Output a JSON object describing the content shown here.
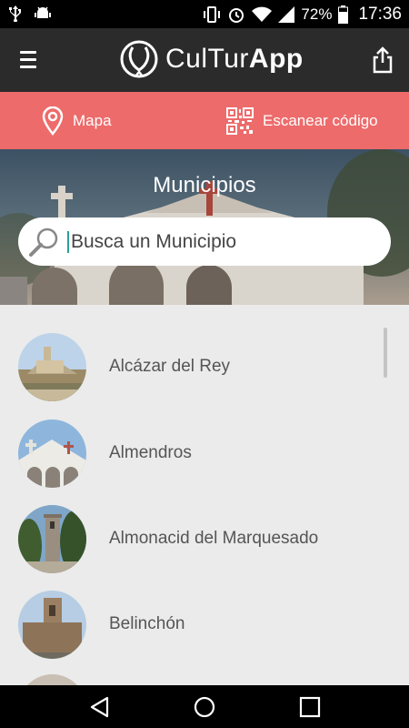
{
  "status_bar": {
    "battery": "72%",
    "time": "17:36"
  },
  "app": {
    "logo_regular": "CulTur",
    "logo_bold": "App"
  },
  "actions": {
    "map_label": "Mapa",
    "scan_label": "Escanear código"
  },
  "hero": {
    "title": "Municipios",
    "search_placeholder": "Busca un Municipio"
  },
  "municipalities": [
    {
      "name": "Alcázar del Rey"
    },
    {
      "name": "Almendros"
    },
    {
      "name": "Almonacid del Marquesado"
    },
    {
      "name": "Belinchón"
    }
  ],
  "colors": {
    "status_bar": "#000000",
    "app_bar": "#2b2b2b",
    "accent": "#ed6b6b",
    "list_bg": "#ebebeb"
  }
}
